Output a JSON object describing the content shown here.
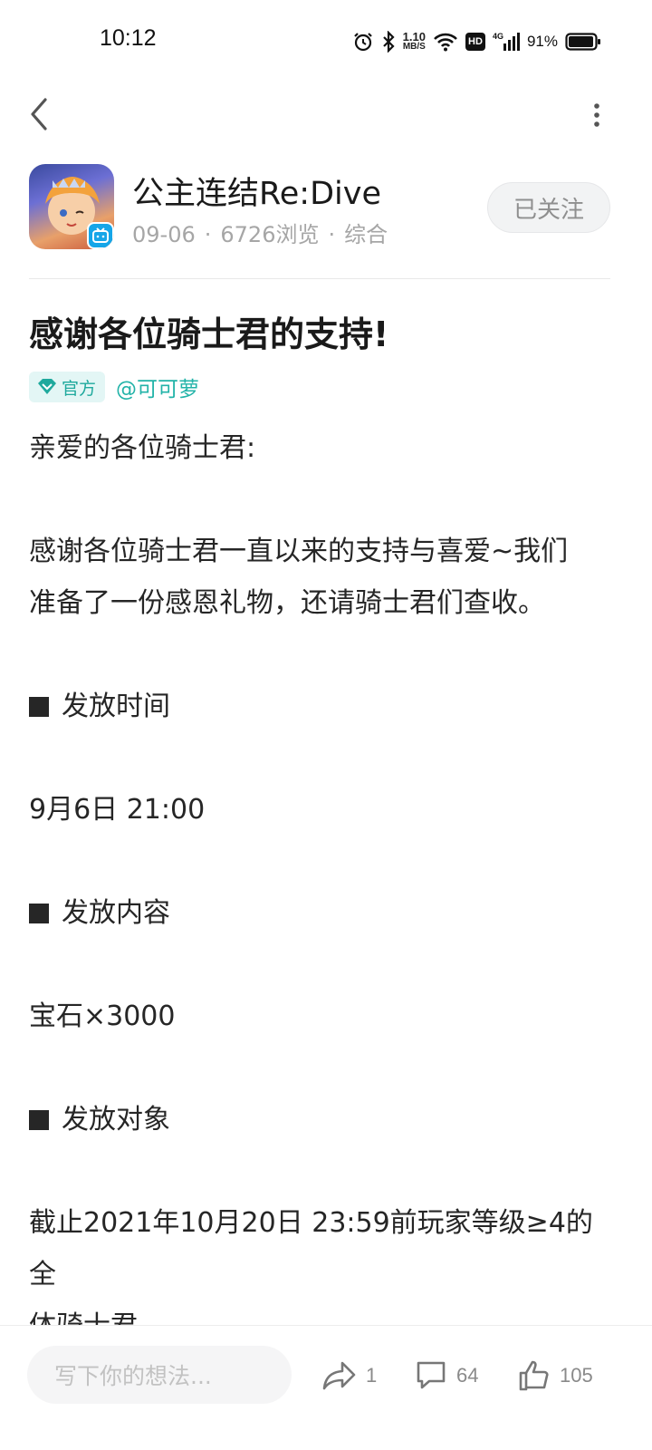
{
  "status_bar": {
    "time": "10:12",
    "net_speed_value": "1.10",
    "net_speed_unit": "MB/S",
    "hd_label": "HD",
    "signal_label": "4G",
    "battery": "91%",
    "icons": [
      "alarm-icon",
      "bluetooth-icon",
      "wifi-icon",
      "signal-icon",
      "battery-icon"
    ]
  },
  "nav": {
    "back_icon": "chevron-left-icon",
    "more_icon": "more-vertical-icon"
  },
  "author": {
    "name": "公主连结Re:Dive",
    "date": "09-06",
    "views": "6726浏览",
    "category": "综合",
    "follow_label": "已关注"
  },
  "post": {
    "title": "感谢各位骑士君的支持!",
    "official_label": "官方",
    "mention": "@可可萝",
    "body": {
      "greeting": "亲爱的各位骑士君:",
      "intro_1": "感谢各位骑士君一直以来的支持与喜爱~我们",
      "intro_2": "准备了一份感恩礼物，还请骑士君们查收。",
      "time_heading": "发放时间",
      "time_value": "9月6日 21:00",
      "content_heading": "发放内容",
      "content_value": "宝石×3000",
      "target_heading": "发放对象",
      "target_value_1": "截止2021年10月20日 23:59前玩家等级≥4的全",
      "target_value_2": "体骑士君"
    }
  },
  "bottom_bar": {
    "comment_placeholder": "写下你的想法...",
    "share_count": "1",
    "comment_count": "64",
    "like_count": "105"
  },
  "colors": {
    "accent": "#22b3a8",
    "tag_bg": "#e3f6f5",
    "muted": "#a6a6a6"
  }
}
